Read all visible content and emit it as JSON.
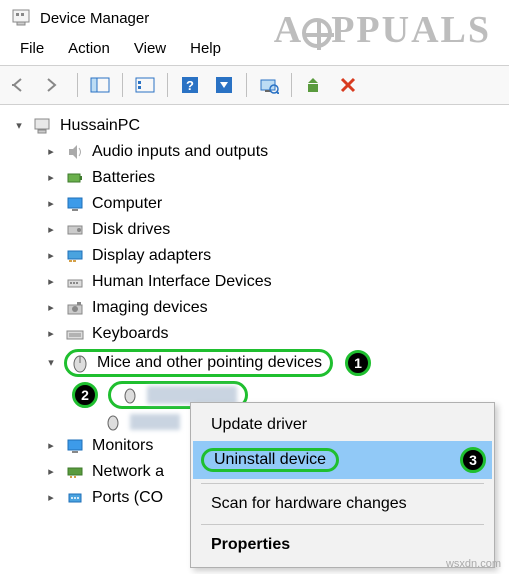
{
  "window": {
    "title": "Device Manager"
  },
  "watermark": "PPUALS",
  "footer_watermark": "wsxdn.com",
  "menu": {
    "file": "File",
    "action": "Action",
    "view": "View",
    "help": "Help"
  },
  "tree": {
    "root": "HussainPC",
    "items": {
      "audio": "Audio inputs and outputs",
      "batteries": "Batteries",
      "computer": "Computer",
      "disk": "Disk drives",
      "display": "Display adapters",
      "hid": "Human Interface Devices",
      "imaging": "Imaging devices",
      "keyboards": "Keyboards",
      "mice": "Mice and other pointing devices",
      "monitors": "Monitors",
      "network": "Network a",
      "ports": "Ports (CO"
    }
  },
  "context": {
    "update": "Update driver",
    "uninstall": "Uninstall device",
    "scan": "Scan for hardware changes",
    "properties": "Properties"
  },
  "steps": {
    "s1": "1",
    "s2": "2",
    "s3": "3"
  }
}
